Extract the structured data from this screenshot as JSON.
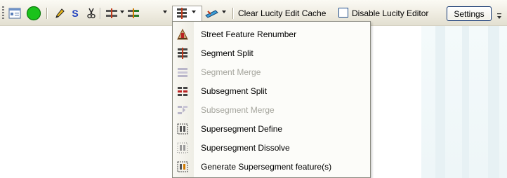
{
  "toolbar": {
    "clear_cache_label": "Clear Lucity Edit Cache",
    "disable_editor_label": "Disable Lucity Editor",
    "disable_editor_checked": false,
    "settings_label": "Settings",
    "s_glyph": "S",
    "icons": [
      "form-icon",
      "green-circle-icon",
      "pencil-icon",
      "s-icon",
      "scissors-icon",
      "segment-tool-icon",
      "segment-tool-2-icon",
      "segment-menu-icon",
      "edit-tool-icon",
      "overflow-chevron-icon"
    ],
    "colors": {
      "accent_green": "#1bc21b",
      "highlight_blue": "#1e4d8c"
    }
  },
  "menu": {
    "items": [
      {
        "label": "Street Feature Renumber",
        "enabled": true,
        "icon": "street-renumber-icon"
      },
      {
        "label": "Segment Split",
        "enabled": true,
        "icon": "segment-split-icon"
      },
      {
        "label": "Segment Merge",
        "enabled": false,
        "icon": "segment-merge-icon"
      },
      {
        "label": "Subsegment Split",
        "enabled": true,
        "icon": "subsegment-split-icon"
      },
      {
        "label": "Subsegment Merge",
        "enabled": false,
        "icon": "subsegment-merge-icon"
      },
      {
        "label": "Supersegment Define",
        "enabled": true,
        "icon": "supersegment-define-icon"
      },
      {
        "label": "Supersegment Dissolve",
        "enabled": true,
        "icon": "supersegment-dissolve-icon"
      },
      {
        "label": "Generate Supersegment feature(s)",
        "enabled": true,
        "icon": "generate-supersegment-icon"
      }
    ]
  }
}
